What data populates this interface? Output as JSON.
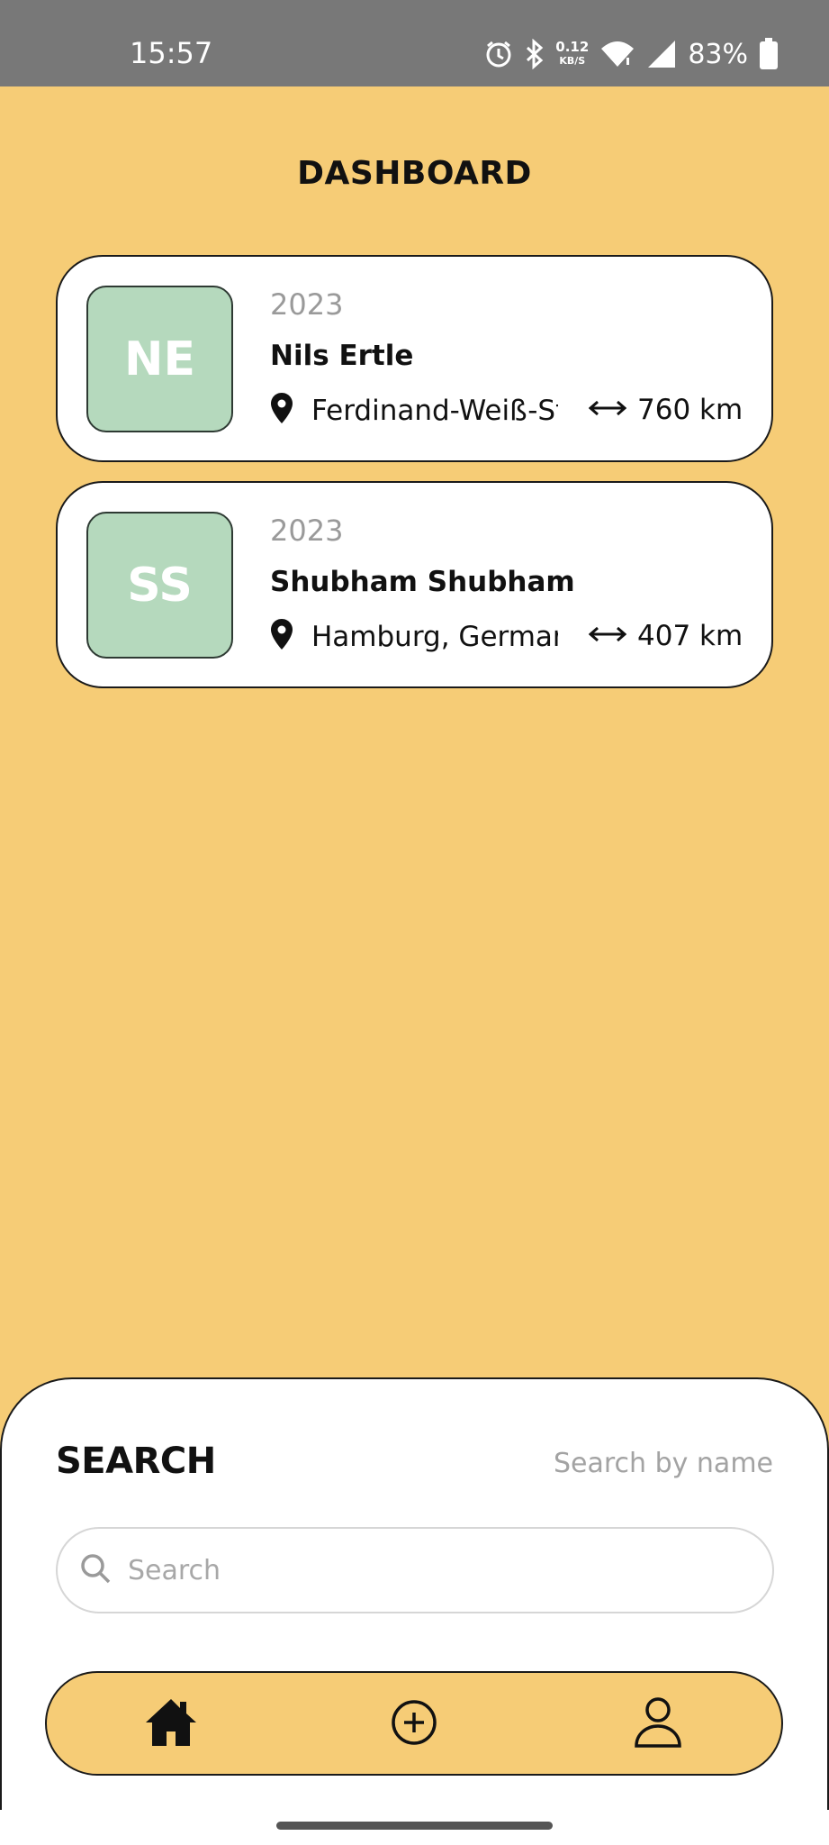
{
  "status_bar": {
    "time": "15:57",
    "net_speed_value": "0.12",
    "net_speed_unit": "KB/S",
    "battery": "83%",
    "icons": [
      "alarm-icon",
      "bluetooth-icon",
      "wifi-icon",
      "signal-icon",
      "battery-icon"
    ]
  },
  "header": {
    "title": "DASHBOARD"
  },
  "cards": [
    {
      "initials": "NE",
      "year": "2023",
      "name": "Nils Ertle",
      "location": "Ferdinand-Weiß-Str",
      "distance": "760 km"
    },
    {
      "initials": "SS",
      "year": "2023",
      "name": "Shubham Shubham",
      "location": "Hamburg, Germany",
      "distance": "407 km"
    }
  ],
  "search": {
    "title": "SEARCH",
    "hint": "Search by name",
    "placeholder": "Search"
  },
  "nav": {
    "items": [
      "home-icon",
      "add-circle-icon",
      "profile-icon"
    ]
  },
  "colors": {
    "background": "#f6cc76",
    "avatar": "#b5d9bd",
    "status_bar": "#787878"
  }
}
